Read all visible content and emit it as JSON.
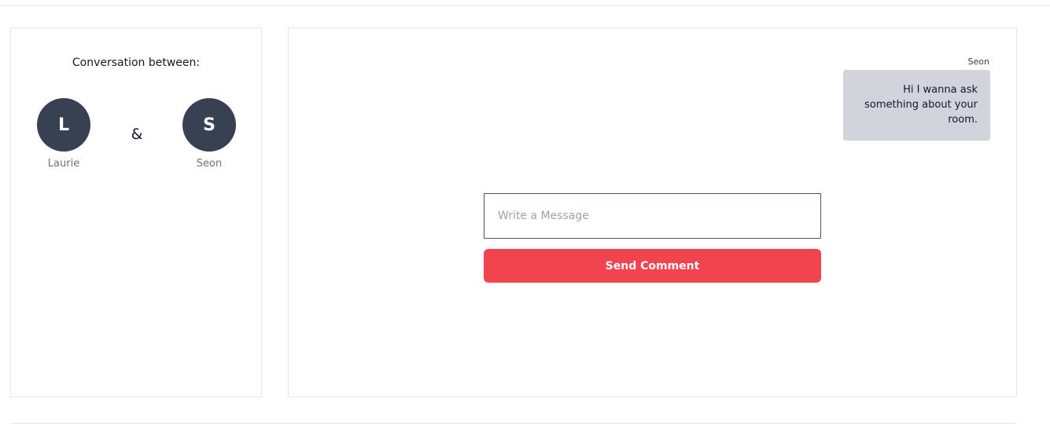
{
  "conversation": {
    "title": "Conversation between:",
    "separator": "&",
    "participants": [
      {
        "initial": "L",
        "name": "Laurie"
      },
      {
        "initial": "S",
        "name": "Seon"
      }
    ]
  },
  "messages": [
    {
      "sender": "Seon",
      "text": "Hi I wanna ask something about your room."
    }
  ],
  "composer": {
    "placeholder": "Write a Message",
    "value": "",
    "send_label": "Send Comment"
  },
  "colors": {
    "avatar_bg": "#374151",
    "bubble_bg": "#d1d5db",
    "accent": "#f2444f"
  }
}
